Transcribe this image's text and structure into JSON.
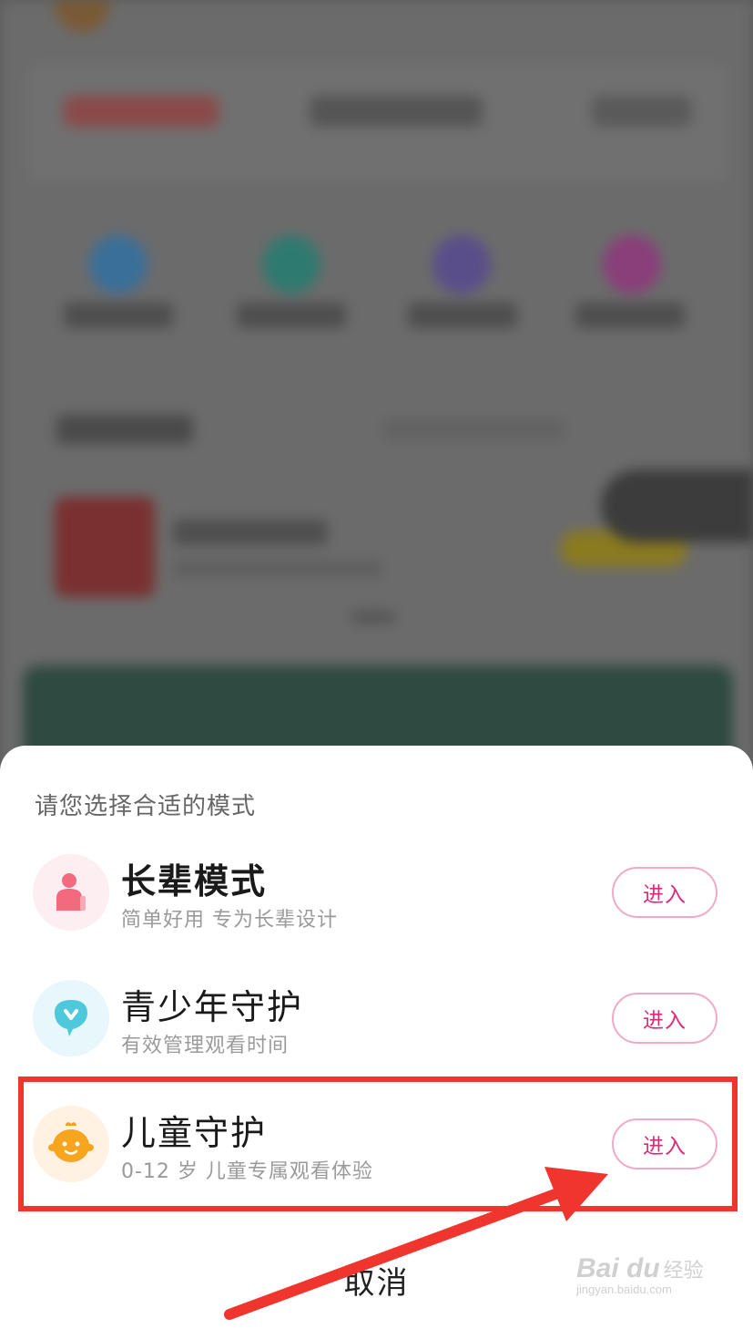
{
  "sheet": {
    "title": "请您选择合适的模式",
    "modes": [
      {
        "name": "长辈模式",
        "desc": "简单好用 专为长辈设计",
        "button": "进入"
      },
      {
        "name": "青少年守护",
        "desc": "有效管理观看时间",
        "button": "进入"
      },
      {
        "name": "儿童守护",
        "desc": "0-12 岁 儿童专属观看体验",
        "button": "进入"
      }
    ],
    "cancel": "取消"
  },
  "watermark": {
    "logo": "Bai du",
    "cn": "经验",
    "url": "jingyan.baidu.com"
  },
  "colors": {
    "accent": "#e0287a",
    "highlight": "#f0352f"
  }
}
